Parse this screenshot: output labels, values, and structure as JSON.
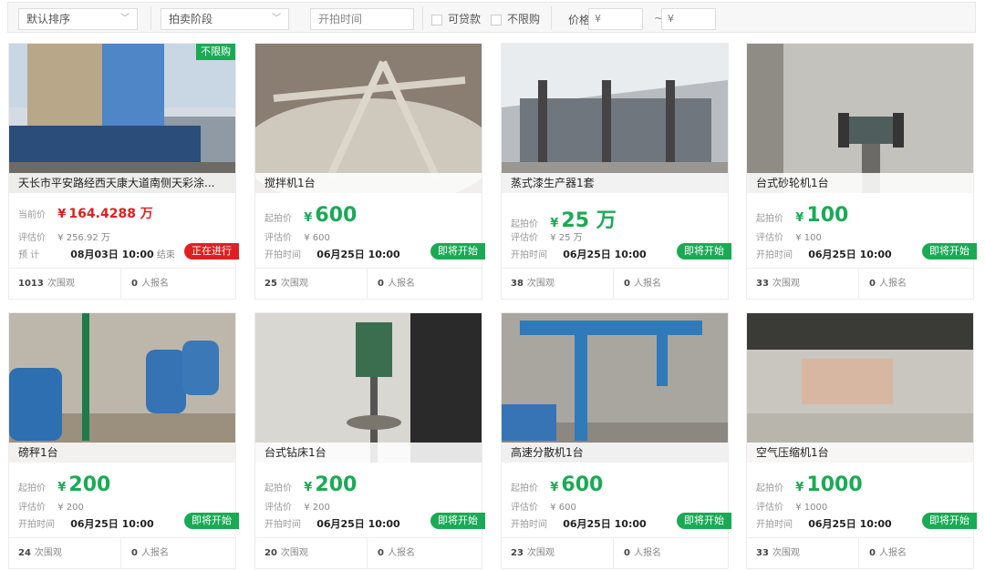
{
  "filters": {
    "sort": "默认排序",
    "stage": "拍卖阶段",
    "start_time_placeholder": "开拍时间",
    "loanable": "可贷款",
    "unlimited": "不限购",
    "price_label": "价格",
    "price_min_placeholder": "¥",
    "price_max_placeholder": "¥",
    "price_separator": "~",
    "chevron": "﹀"
  },
  "cards": [
    {
      "title": "天长市平安路经西天康大道南侧天彩涂...",
      "tag": "不限购",
      "price_label": "当前价",
      "price_yen": "¥",
      "price": "164.4288 万",
      "assess_label": "评估价",
      "assess": "¥ 256.92 万",
      "time_label": "预 计",
      "time": "08月03日 10:00",
      "time_suffix": "结束",
      "status": "正在进行",
      "views": "1013",
      "views_label": "次围观",
      "signups": "0",
      "signups_label": "人报名"
    },
    {
      "title": "搅拌机1台",
      "price_label": "起拍价",
      "price_yen": "¥",
      "price": "600",
      "assess_label": "评估价",
      "assess": "¥ 600",
      "time_label": "开拍时间",
      "time": "06月25日 10:00",
      "status": "即将开始",
      "views": "25",
      "views_label": "次围观",
      "signups": "0",
      "signups_label": "人报名"
    },
    {
      "title": "蒸式漆生产器1套",
      "price_label": "起拍价",
      "price_yen": "¥",
      "price": "25 万",
      "assess_label": "评估价",
      "assess": "¥ 25 万",
      "time_label": "开拍时间",
      "time": "06月25日 10:00",
      "status": "即将开始",
      "views": "38",
      "views_label": "次围观",
      "signups": "0",
      "signups_label": "人报名"
    },
    {
      "title": "台式砂轮机1台",
      "price_label": "起拍价",
      "price_yen": "¥",
      "price": "100",
      "assess_label": "评估价",
      "assess": "¥ 100",
      "time_label": "开拍时间",
      "time": "06月25日 10:00",
      "status": "即将开始",
      "views": "33",
      "views_label": "次围观",
      "signups": "0",
      "signups_label": "人报名"
    },
    {
      "title": "磅秤1台",
      "price_label": "起拍价",
      "price_yen": "¥",
      "price": "200",
      "assess_label": "评估价",
      "assess": "¥ 200",
      "time_label": "开拍时间",
      "time": "06月25日 10:00",
      "status": "即将开始",
      "views": "24",
      "views_label": "次围观",
      "signups": "0",
      "signups_label": "人报名"
    },
    {
      "title": "台式钻床1台",
      "price_label": "起拍价",
      "price_yen": "¥",
      "price": "200",
      "assess_label": "评估价",
      "assess": "¥ 200",
      "time_label": "开拍时间",
      "time": "06月25日 10:00",
      "status": "即将开始",
      "views": "20",
      "views_label": "次围观",
      "signups": "0",
      "signups_label": "人报名"
    },
    {
      "title": "高速分散机1台",
      "price_label": "起拍价",
      "price_yen": "¥",
      "price": "600",
      "assess_label": "评估价",
      "assess": "¥ 600",
      "time_label": "开拍时间",
      "time": "06月25日 10:00",
      "status": "即将开始",
      "views": "23",
      "views_label": "次围观",
      "signups": "0",
      "signups_label": "人报名"
    },
    {
      "title": "空气压缩机1台",
      "price_label": "起拍价",
      "price_yen": "¥",
      "price": "1000",
      "assess_label": "评估价",
      "assess": "¥ 1000",
      "time_label": "开拍时间",
      "time": "06月25日 10:00",
      "status": "即将开始",
      "views": "33",
      "views_label": "次围观",
      "signups": "0",
      "signups_label": "人报名"
    }
  ],
  "colors": {
    "accent_green": "#1aaa55",
    "accent_red": "#e02020"
  }
}
